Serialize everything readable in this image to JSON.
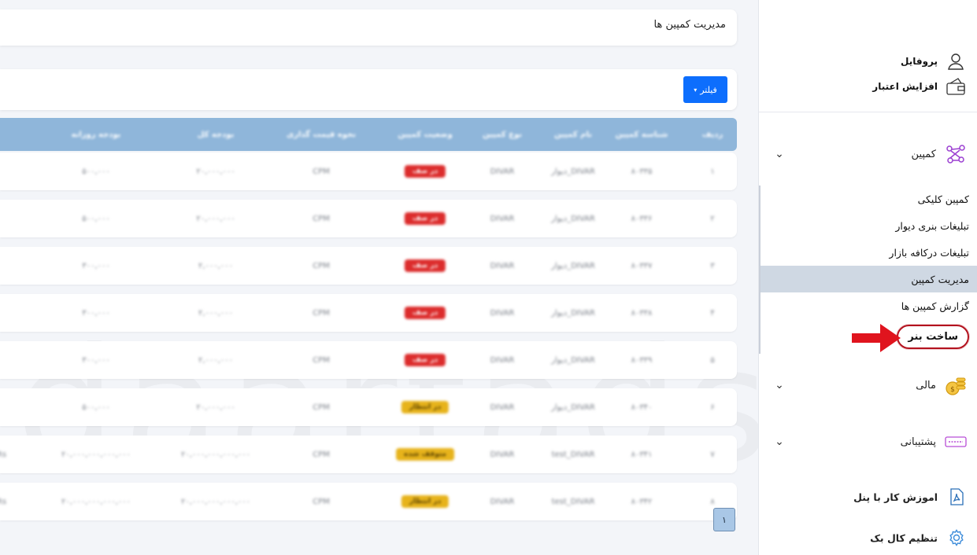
{
  "header": {
    "page_title": "مدیریت کمپین ها"
  },
  "filter": {
    "label": "فیلتر",
    "caret": "▾"
  },
  "watermark": "daartads.com",
  "sidebar": {
    "top_links": [
      {
        "label": "پروفایل",
        "icon": "user-icon"
      },
      {
        "label": "افزایش اعتبار",
        "icon": "wallet-icon"
      }
    ],
    "groups": {
      "campaign": {
        "label": "کمپین",
        "icon": "campaign-icon",
        "chevron": "⌄"
      },
      "finance": {
        "label": "مالی",
        "icon": "coins-icon",
        "chevron": "⌄"
      },
      "support": {
        "label": "پشتیبانی",
        "icon": "ticket-icon",
        "chevron": "⌄"
      }
    },
    "campaign_items": [
      {
        "label": "کمپین کلیکی"
      },
      {
        "label": "تبلیغات بنری دیوار"
      },
      {
        "label": "تبلیغات درکافه بازار"
      },
      {
        "label": "مدیریت کمپین",
        "active": true
      },
      {
        "label": "گزارش کمپین ها"
      },
      {
        "label": "ساخت بنر",
        "highlight": true
      }
    ],
    "bottom_links": [
      {
        "label": "اموزش کار با پنل",
        "icon": "pdf-icon"
      },
      {
        "label": "تنظیم کال بک",
        "icon": "gear-icon"
      }
    ]
  },
  "table": {
    "headers": [
      "ردیف",
      "شناسه کمپین",
      "نام کمپین",
      "نوع کمپین",
      "وضعیت کمپین",
      "نحوه قیمت گذاری",
      "بودجه کل",
      "بودجه روزانه",
      ""
    ],
    "rows": [
      {
        "cells": [
          "۱",
          "۸۰۳۳۵",
          "دیوار_DIVAR",
          "DIVAR",
          "در صف",
          "CPM",
          "۲۰,۰۰۰,۰۰۰",
          "۵۰۰,۰۰۰",
          ""
        ],
        "badge": "red"
      },
      {
        "cells": [
          "۲",
          "۸۰۳۳۶",
          "دیوار_DIVAR",
          "DIVAR",
          "در صف",
          "CPM",
          "۲۰,۰۰۰,۰۰۰",
          "۵۰۰,۰۰۰",
          ""
        ],
        "badge": "red"
      },
      {
        "cells": [
          "۳",
          "۸۰۳۳۷",
          "دیوار_DIVAR",
          "DIVAR",
          "در صف",
          "CPM",
          "۲,۰۰۰,۰۰۰",
          "۳۰۰,۰۰۰",
          ""
        ],
        "badge": "red"
      },
      {
        "cells": [
          "۴",
          "۸۰۳۳۸",
          "دیوار_DIVAR",
          "DIVAR",
          "در صف",
          "CPM",
          "۲,۰۰۰,۰۰۰",
          "۳۰۰,۰۰۰",
          ""
        ],
        "badge": "red"
      },
      {
        "cells": [
          "۵",
          "۸۰۳۳۹",
          "دیوار_DIVAR",
          "DIVAR",
          "در صف",
          "CPM",
          "۲,۰۰۰,۰۰۰",
          "۳۰۰,۰۰۰",
          ""
        ],
        "badge": "red"
      },
      {
        "cells": [
          "۶",
          "۸۰۳۴۰",
          "دیوار_DIVAR",
          "DIVAR",
          "در انتظار",
          "CPM",
          "۲۰,۰۰۰,۰۰۰",
          "۵۰۰,۰۰۰",
          ""
        ],
        "badge": "yellow"
      },
      {
        "cells": [
          "۷",
          "۸۰۳۴۱",
          "test_DIVAR",
          "DIVAR",
          "متوقف شده",
          "CPM",
          "۲۰,۰۰۰,۰۰۰,۰۰۰,۰۰۰",
          "۲۰,۰۰۰,۰۰۰,۰۰۰,۰۰۰",
          "Rs"
        ],
        "badge": "yellow"
      },
      {
        "cells": [
          "۸",
          "۸۰۳۴۲",
          "test_DIVAR",
          "DIVAR",
          "در انتظار",
          "CPM",
          "۲۰,۰۰۰,۰۰۰,۰۰۰,۰۰۰",
          "۲۰,۰۰۰,۰۰۰,۰۰۰,۰۰۰",
          "Rs"
        ],
        "badge": "yellow"
      }
    ]
  },
  "pagination": {
    "current": "۱"
  }
}
